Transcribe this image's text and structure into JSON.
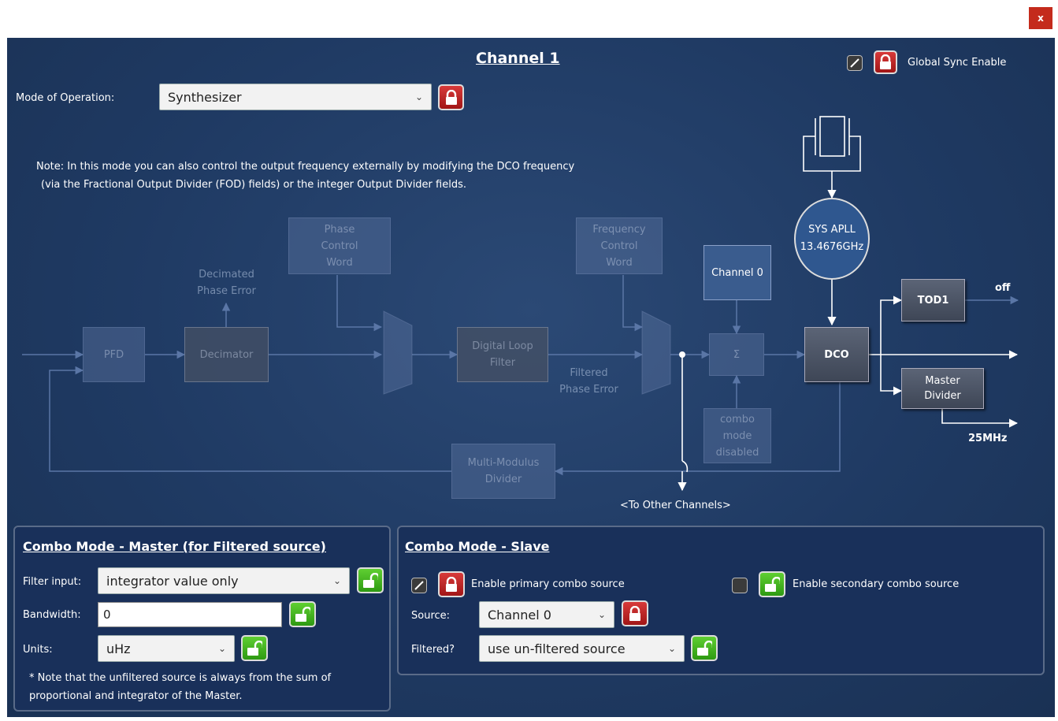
{
  "window": {
    "close_label": "x"
  },
  "header": {
    "title": "Channel 1",
    "global_sync_label": "Global Sync Enable"
  },
  "mode": {
    "label": "Mode of Operation:",
    "value": "Synthesizer"
  },
  "note": {
    "line1": "Note: In this mode you can also control the output frequency externally by modifying the DCO frequency",
    "line2": "(via the Fractional Output Divider (FOD) fields) or the integer Output Divider fields."
  },
  "diagram": {
    "pfd": "PFD",
    "decimator": "Decimator",
    "decimated_error": [
      "Decimated",
      "Phase Error"
    ],
    "phase_control_word": [
      "Phase",
      "Control",
      "Word"
    ],
    "digital_loop_filter": [
      "Digital Loop",
      "Filter"
    ],
    "filtered_phase_error": [
      "Filtered",
      "Phase Error"
    ],
    "frequency_control_word": [
      "Frequency",
      "Control",
      "Word"
    ],
    "channel0": "Channel 0",
    "sigma": "Σ",
    "combo_disabled": [
      "combo",
      "mode",
      "disabled"
    ],
    "sys_apll": [
      "SYS APLL",
      "13.4676GHz"
    ],
    "dco": "DCO",
    "tod1": "TOD1",
    "tod1_output": "off",
    "master_divider": [
      "Master",
      "Divider"
    ],
    "master_output": "25MHz",
    "multi_modulus": [
      "Multi-Modulus",
      "Divider"
    ],
    "to_other_channels": "<To Other Channels>"
  },
  "combo_master": {
    "title": "Combo Mode - Master (for Filtered source)",
    "filter_input_label": "Filter input:",
    "filter_input_value": "integrator value only",
    "bandwidth_label": "Bandwidth:",
    "bandwidth_value": "0",
    "units_label": "Units:",
    "units_value": "uHz",
    "note_line1": "* Note that the unfiltered source is always from the sum of",
    "note_line2": "proportional and integrator of the Master."
  },
  "combo_slave": {
    "title": "Combo Mode - Slave",
    "enable_primary_label": "Enable primary combo source",
    "enable_secondary_label": "Enable secondary combo source",
    "source_label": "Source:",
    "source_value": "Channel 0",
    "filtered_label": "Filtered?",
    "filtered_value": "use un-filtered source"
  },
  "colors": {
    "panel_bg": "#1f3a63",
    "close_red": "#c42b1c",
    "lock_red": "#c62020",
    "lock_green": "#3fb31c"
  }
}
